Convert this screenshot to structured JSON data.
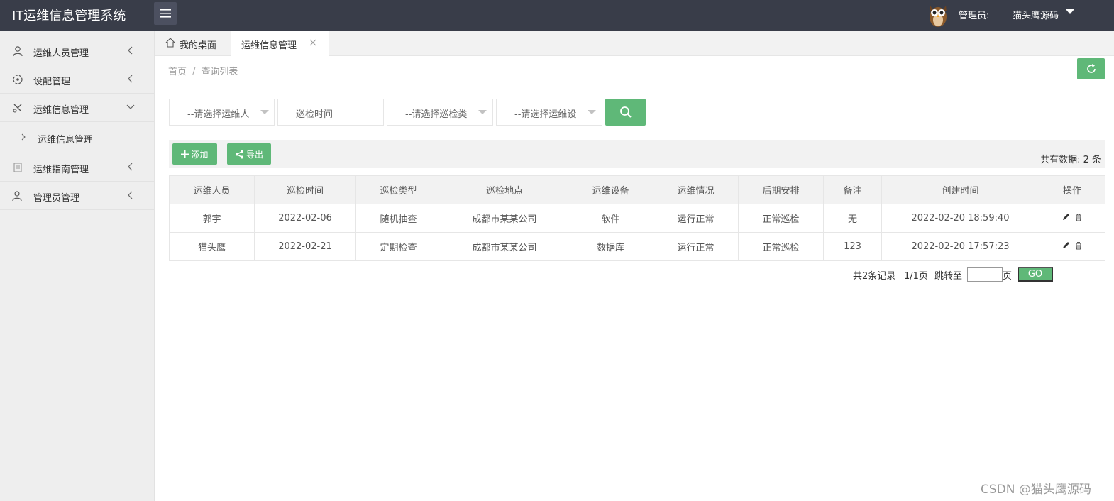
{
  "app": {
    "title": "IT运维信息管理系统"
  },
  "header": {
    "admin_label": "管理员:",
    "admin_name": "猫头鹰源码"
  },
  "sidebar": {
    "items": [
      {
        "label": "运维人员管理",
        "icon": "user-icon"
      },
      {
        "label": "设配管理",
        "icon": "settings-icon"
      },
      {
        "label": "运维信息管理",
        "icon": "tools-icon",
        "expanded": true,
        "children": [
          {
            "label": "运维信息管理"
          }
        ]
      },
      {
        "label": "运维指南管理",
        "icon": "document-icon"
      },
      {
        "label": "管理员管理",
        "icon": "users-icon"
      }
    ]
  },
  "tabs": [
    {
      "label": "我的桌面",
      "icon": "home-icon"
    },
    {
      "label": "运维信息管理",
      "active": true
    }
  ],
  "breadcrumb": {
    "home": "首页",
    "sep": "/",
    "current": "查询列表"
  },
  "search": {
    "person_placeholder": "--请选择运维人",
    "time_placeholder": "巡检时间",
    "type_placeholder": "--请选择巡检类",
    "device_placeholder": "--请选择运维设"
  },
  "toolbar": {
    "add_label": "添加",
    "export_label": "导出",
    "total_text": "共有数据: 2 条"
  },
  "table": {
    "headers": [
      "运维人员",
      "巡检时间",
      "巡检类型",
      "巡检地点",
      "运维设备",
      "运维情况",
      "后期安排",
      "备注",
      "创建时间",
      "操作"
    ],
    "rows": [
      [
        "郭宇",
        "2022-02-06",
        "随机抽查",
        "成都市某某公司",
        "软件",
        "运行正常",
        "正常巡检",
        "无",
        "2022-02-20 18:59:40"
      ],
      [
        "猫头鹰",
        "2022-02-21",
        "定期检查",
        "成都市某某公司",
        "数据库",
        "运行正常",
        "正常巡检",
        "123",
        "2022-02-20 17:57:23"
      ]
    ]
  },
  "pager": {
    "total": "共2条记录",
    "pages": "1/1页",
    "jump": "跳转至",
    "unit": "页",
    "go": "GO"
  },
  "watermark": "CSDN @猫头鹰源码",
  "colors": {
    "header_bg": "#393d49",
    "accent_green": "#5fb878",
    "sidebar_bg": "#eeeeee"
  }
}
